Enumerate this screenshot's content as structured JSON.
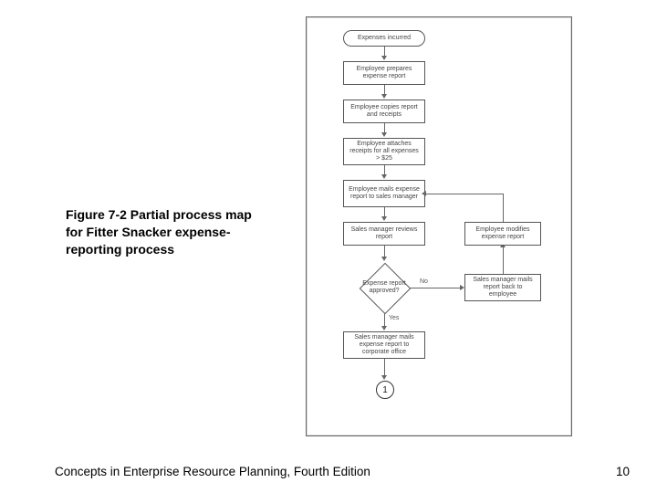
{
  "caption": "Figure 7-2  Partial process map for Fitter Snacker expense-reporting process",
  "footer_left": "Concepts in Enterprise Resource Planning, Fourth Edition",
  "footer_right": "10",
  "flow": {
    "start": "Expenses incurred",
    "n1": "Employee prepares expense report",
    "n2": "Employee copies report and receipts",
    "n3": "Employee attaches receipts for all expenses > $25",
    "n4": "Employee mails expense report to sales manager",
    "n5": "Sales manager reviews report",
    "d1": "Expense report approved?",
    "d1_yes": "Yes",
    "d1_no": "No",
    "n6": "Sales manager mails expense report to corporate office",
    "r1": "Employee modifies expense report",
    "r2": "Sales manager mails report back to employee",
    "connector": "1"
  }
}
